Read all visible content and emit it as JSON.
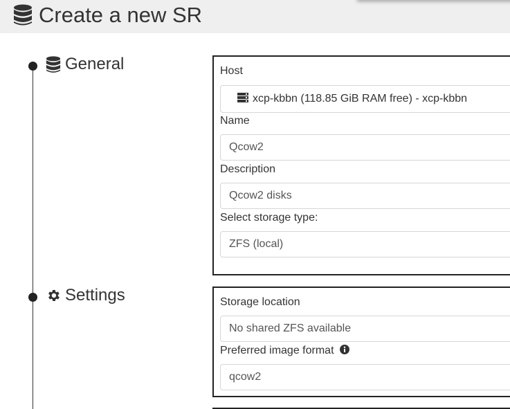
{
  "header": {
    "title": "Create a new SR",
    "icon": "database-icon"
  },
  "sections": {
    "general": {
      "heading": "General",
      "icon": "database-icon",
      "host": {
        "label": "Host",
        "value": "xcp-kbbn (118.85 GiB RAM free) - xcp-kbbn",
        "icon": "server-icon"
      },
      "name": {
        "label": "Name",
        "value": "Qcow2"
      },
      "description": {
        "label": "Description",
        "value": "Qcow2 disks"
      },
      "storage_type": {
        "label": "Select storage type:",
        "value": "ZFS (local)"
      }
    },
    "settings": {
      "heading": "Settings",
      "icon": "gear-icon",
      "storage_location": {
        "label": "Storage location",
        "value": "No shared ZFS available"
      },
      "image_format": {
        "label": "Preferred image format",
        "value": "qcow2",
        "info_icon": "info-circle-icon"
      }
    }
  },
  "colors": {
    "header_bg": "#efefef",
    "text": "#333333",
    "border": "#222222",
    "input_border": "#d6d6d6"
  }
}
